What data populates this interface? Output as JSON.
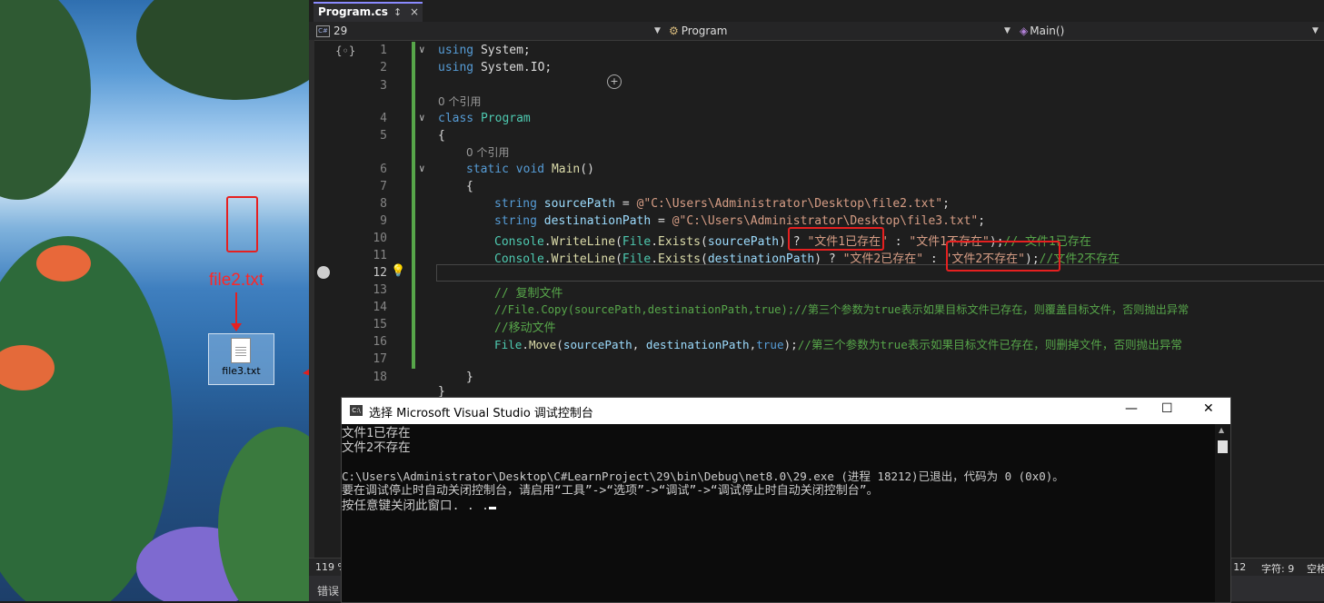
{
  "desktop": {
    "note": "file2.txt",
    "file_icon_label": "file3.txt"
  },
  "editor": {
    "tab": {
      "title": "Program.cs",
      "pin": "↕",
      "close": "×"
    },
    "nav": {
      "project": "29",
      "class": "Program",
      "member": "Main()"
    },
    "lines": [
      {
        "n": "1"
      },
      {
        "n": "2"
      },
      {
        "n": "3"
      },
      {
        "n": "4"
      },
      {
        "n": "5"
      },
      {
        "n": "6"
      },
      {
        "n": "7"
      },
      {
        "n": "8"
      },
      {
        "n": "9"
      },
      {
        "n": "10"
      },
      {
        "n": "11"
      },
      {
        "n": "12"
      },
      {
        "n": "13"
      },
      {
        "n": "14"
      },
      {
        "n": "15"
      },
      {
        "n": "16"
      },
      {
        "n": "17"
      },
      {
        "n": "18"
      }
    ],
    "code": {
      "l1_using": "using",
      "l1_ns": "System;",
      "l2_using": "using",
      "l2_ns": "System.IO;",
      "ref1": "0 个引用",
      "l4_class": "class",
      "l4_name": "Program",
      "l5": "{",
      "ref2": "0 个引用",
      "l6_static": "static",
      "l6_void": "void",
      "l6_name": "Main",
      "l6_paren": "()",
      "l7": "{",
      "l8_type": "string",
      "l8_var": "sourcePath",
      "l8_eq": " = ",
      "l8_str": "@\"C:\\Users\\Administrator\\Desktop\\file2.txt\"",
      "l8_end": ";",
      "l9_type": "string",
      "l9_var": "destinationPath",
      "l9_eq": " = ",
      "l9_str": "@\"C:\\Users\\Administrator\\Desktop\\file3.txt\"",
      "l9_end": ";",
      "l10_a": "Console",
      "l10_b": ".",
      "l10_c": "WriteLine",
      "l10_d": "(",
      "l10_e": "File",
      "l10_f": ".",
      "l10_g": "Exists",
      "l10_h": "(",
      "l10_i": "sourcePath",
      "l10_j": ") ? ",
      "l10_s1": "\"文件1已存在\"",
      "l10_k": " : ",
      "l10_s2": "\"文件1不存在\"",
      "l10_l": ");",
      "l10_cm": "// 文件1已存在",
      "l11_a": "Console",
      "l11_b": ".",
      "l11_c": "WriteLine",
      "l11_d": "(",
      "l11_e": "File",
      "l11_f": ".",
      "l11_g": "Exists",
      "l11_h": "(",
      "l11_i": "destinationPath",
      "l11_j": ") ? ",
      "l11_s1": "\"文件2已存在\"",
      "l11_k": " : ",
      "l11_s2": "\"文件2不存在\"",
      "l11_l": ");",
      "l11_cm": "//文件2不存在",
      "l13_cm": "// 复制文件",
      "l14_cm": "//File.Copy(sourcePath,destinationPath,true);//第三个参数为true表示如果目标文件已存在，则覆盖目标文件，否则抛出异常",
      "l15_cm": "//移动文件",
      "l16_a": "File",
      "l16_b": ".",
      "l16_c": "Move",
      "l16_d": "(",
      "l16_e": "sourcePath",
      "l16_f": ", ",
      "l16_g": "destinationPath",
      "l16_h": ",",
      "l16_i": "true",
      "l16_j": ");",
      "l16_cm": "//第三个参数为true表示如果目标文件已存在，则删掉文件，否则抛出异常",
      "l17": "}",
      "l18": "}"
    },
    "status": {
      "zoom": "119 %",
      "line": ": 12",
      "col": "字符: 9",
      "ins": "空格"
    },
    "bottom_tab": "错误"
  },
  "console": {
    "title": "选择 Microsoft Visual Studio 调试控制台",
    "icon": "C:\\",
    "btn_min": "—",
    "btn_max": "☐",
    "btn_close": "✕",
    "lines": [
      "文件1已存在",
      "文件2不存在",
      "",
      "C:\\Users\\Administrator\\Desktop\\C#LearnProject\\29\\bin\\Debug\\net8.0\\29.exe (进程 18212)已退出，代码为 0 (0x0)。",
      "要在调试停止时自动关闭控制台，请启用“工具”->“选项”->“调试”->“调试停止时自动关闭控制台”。",
      "按任意键关闭此窗口. . ."
    ]
  }
}
